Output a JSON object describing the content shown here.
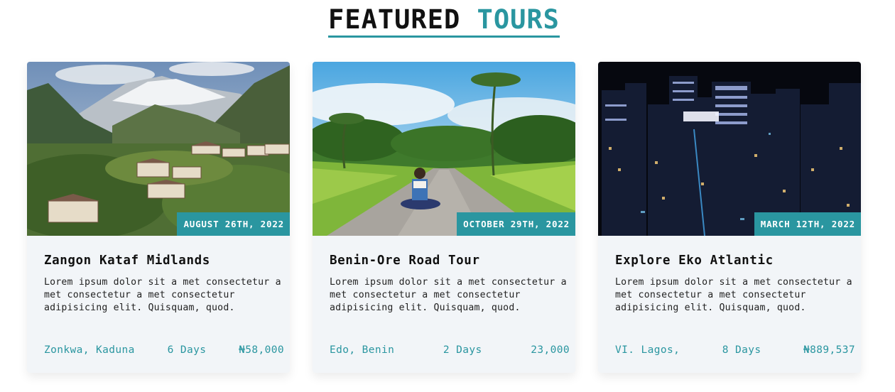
{
  "section": {
    "title_part1": "FEATURED",
    "title_part2": "TOURS"
  },
  "colors": {
    "accent": "#2a96a0",
    "card_bg": "#f2f5f8"
  },
  "tours": [
    {
      "image_icon": "mountain-village-photo",
      "date": "AUGUST 26TH, 2022",
      "title": "Zangon Kataf Midlands",
      "description": "Lorem ipsum dolor sit a met consectetur a met consectetur a met consectetur adipisicing elit. Quisquam, quod.",
      "location": "Zonkwa, Kaduna",
      "duration": "6 Days",
      "price": "₦58,000"
    },
    {
      "image_icon": "tropical-road-photo",
      "date": "OCTOBER 29TH, 2022",
      "title": "Benin-Ore Road Tour",
      "description": "Lorem ipsum dolor sit a met consectetur a met consectetur a met consectetur adipisicing elit. Quisquam, quod.",
      "location": "Edo, Benin",
      "duration": "2 Days",
      "price": "23,000"
    },
    {
      "image_icon": "night-city-photo",
      "date": "MARCH 12TH, 2022",
      "title": "Explore Eko Atlantic",
      "description": "Lorem ipsum dolor sit a met consectetur a met consectetur a met consectetur adipisicing elit. Quisquam, quod.",
      "location": "VI. Lagos,",
      "duration": "8 Days",
      "price": "₦889,537"
    }
  ]
}
